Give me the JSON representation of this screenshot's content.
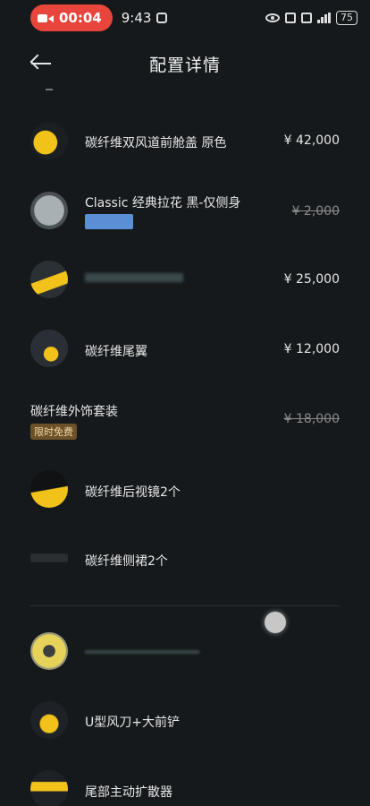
{
  "status_bar": {
    "record_time": "00:04",
    "clock": "9:43",
    "battery": "75"
  },
  "header": {
    "title": "配置详情"
  },
  "items": [
    {
      "name": "碳纤维双风道前舱盖 原色",
      "price": "¥ 42,000",
      "thumb_colors": [
        "#f0c21a",
        "#1b1f22"
      ]
    },
    {
      "name": "Classic 经典拉花 黑-仅侧身",
      "price": "¥ 2,000",
      "thumb_colors": [
        "#9aa3a6",
        "#4a5155"
      ]
    },
    {
      "name": "",
      "price": "¥ 25,000",
      "thumb_colors": [
        "#f0c21a",
        "#2b3034"
      ]
    },
    {
      "name": "碳纤维尾翼",
      "price": "¥ 12,000",
      "thumb_colors": [
        "#f0c21a",
        "#2a2f36"
      ]
    },
    {
      "name": "碳纤维外饰套装",
      "price": "¥ 18,000",
      "badge": "限时免费"
    },
    {
      "name": "碳纤维后视镜2个",
      "price": "",
      "thumb_colors": [
        "#f0c21a",
        "#101214"
      ]
    },
    {
      "name": "碳纤维侧裙2个",
      "price": "",
      "thumb_colors": [
        "#2b2f33",
        "#c9a33a"
      ]
    },
    {
      "name": "",
      "price": "",
      "thumb_colors": [
        "#e7d35a",
        "#3c3f41"
      ]
    },
    {
      "name": "U型风刀+大前铲",
      "price": "",
      "thumb_colors": [
        "#f0c21a",
        "#1e2226"
      ]
    },
    {
      "name": "尾部主动扩散器",
      "price": "",
      "thumb_colors": [
        "#f0c21a",
        "#1e2226"
      ]
    }
  ]
}
